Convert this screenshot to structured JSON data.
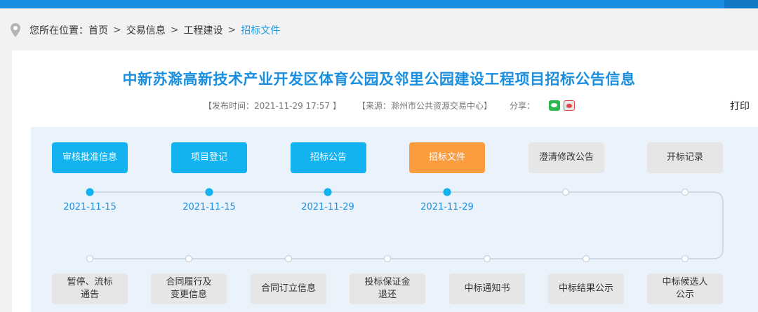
{
  "breadcrumb": {
    "prefix": "您所在位置：",
    "items": [
      "首页",
      "交易信息",
      "工程建设",
      "招标文件"
    ],
    "separator": ">"
  },
  "article": {
    "title": "中新苏滁高新技术产业开发区体育公园及邻里公园建设工程项目招标公告信息",
    "publish": "【发布时间：2021-11-29 17:57 】",
    "source": "【来源：滁州市公共资源交易中心】",
    "share_label": "分享：",
    "print_label": "打印"
  },
  "share_icons": [
    "wechat-icon",
    "weibo-icon"
  ],
  "colors": {
    "done": "#12b3f0",
    "current": "#fb9d3f",
    "pending": "#e6e6e6",
    "accent": "#1a8ee0"
  },
  "flow_top": [
    {
      "label": "审核批准信息",
      "date": "2021-11-15",
      "state": "done"
    },
    {
      "label": "项目登记",
      "date": "2021-11-15",
      "state": "done"
    },
    {
      "label": "招标公告",
      "date": "2021-11-29",
      "state": "done"
    },
    {
      "label": "招标文件",
      "date": "2021-11-29",
      "state": "current"
    },
    {
      "label": "澄清修改公告",
      "date": "",
      "state": "pending"
    },
    {
      "label": "开标记录",
      "date": "",
      "state": "pending"
    }
  ],
  "flow_bottom": [
    {
      "label": "暂停、流标\n通告"
    },
    {
      "label": "合同履行及\n变更信息"
    },
    {
      "label": "合同订立信息"
    },
    {
      "label": "投标保证金\n退还"
    },
    {
      "label": "中标通知书"
    },
    {
      "label": "中标结果公示"
    },
    {
      "label": "中标候选人\n公示"
    }
  ]
}
